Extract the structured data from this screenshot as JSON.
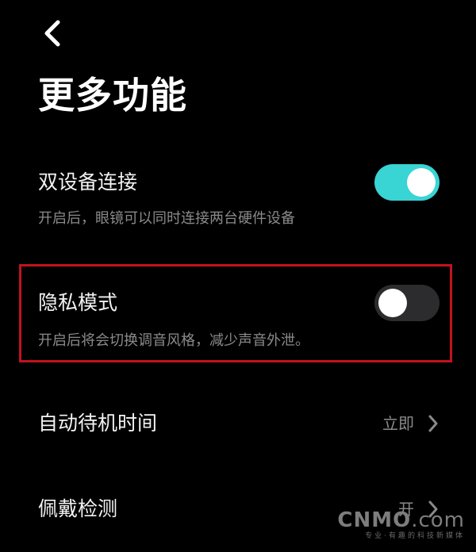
{
  "header": {
    "back_icon": "chevron-left-icon",
    "title": "更多功能"
  },
  "settings": {
    "dual_device": {
      "label": "双设备连接",
      "description": "开启后，眼镜可以同时连接两台硬件设备",
      "enabled": true
    },
    "privacy_mode": {
      "label": "隐私模式",
      "description": "开启后将会切换调音风格，减少声音外泄。",
      "enabled": false,
      "highlighted": true
    },
    "auto_standby": {
      "label": "自动待机时间",
      "value": "立即",
      "icon": "chevron-right-icon"
    },
    "wear_detection": {
      "label": "佩戴检测",
      "value": "开",
      "icon": "chevron-right-icon"
    }
  },
  "watermark": {
    "logo": "CNMO",
    "logo_suffix": ".com",
    "tagline": "专业·有趣的科技新媒体"
  },
  "colors": {
    "background": "#000000",
    "toggle_on": "#39d4d4",
    "toggle_off": "#2c2c2e",
    "highlight_border": "#c1121f",
    "secondary_text": "#8a8a8a"
  }
}
